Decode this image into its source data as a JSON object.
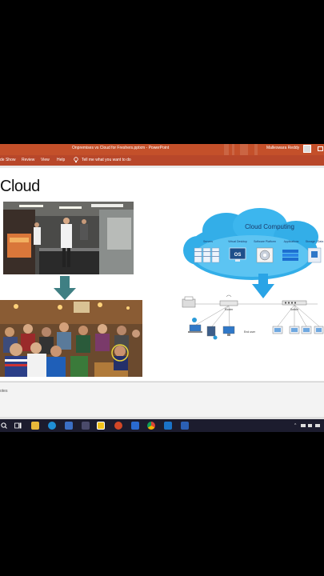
{
  "window": {
    "title": "Onpremises vs Cloud for Freshers.pptxm  -  PowerPoint",
    "user_name": "Malleswara Reddy"
  },
  "ribbon": {
    "tabs": [
      "de Show",
      "Review",
      "View",
      "Help"
    ],
    "tell_me": "Tell me what you want to do"
  },
  "slide": {
    "title": "Cloud"
  },
  "cloud_diagram": {
    "heading": "Cloud Computing",
    "services": [
      "Servers",
      "Virtual Desktop",
      "Software Platform",
      "Applications",
      "Storage / Data"
    ],
    "os_label": "OS",
    "router_label": "Router",
    "switch_label": "Switch",
    "end_user_label": "End user"
  },
  "notes": {
    "label": "otes"
  },
  "taskbar": {
    "icons": [
      "start-icon",
      "search-icon",
      "task-view-icon",
      "file-explorer-icon",
      "edge-icon",
      "store-icon",
      "app-icon",
      "sticky-notes-icon",
      "powerpoint-icon",
      "teams-icon",
      "chrome-icon",
      "mail-icon",
      "word-icon"
    ],
    "accent": "#c4502a"
  }
}
